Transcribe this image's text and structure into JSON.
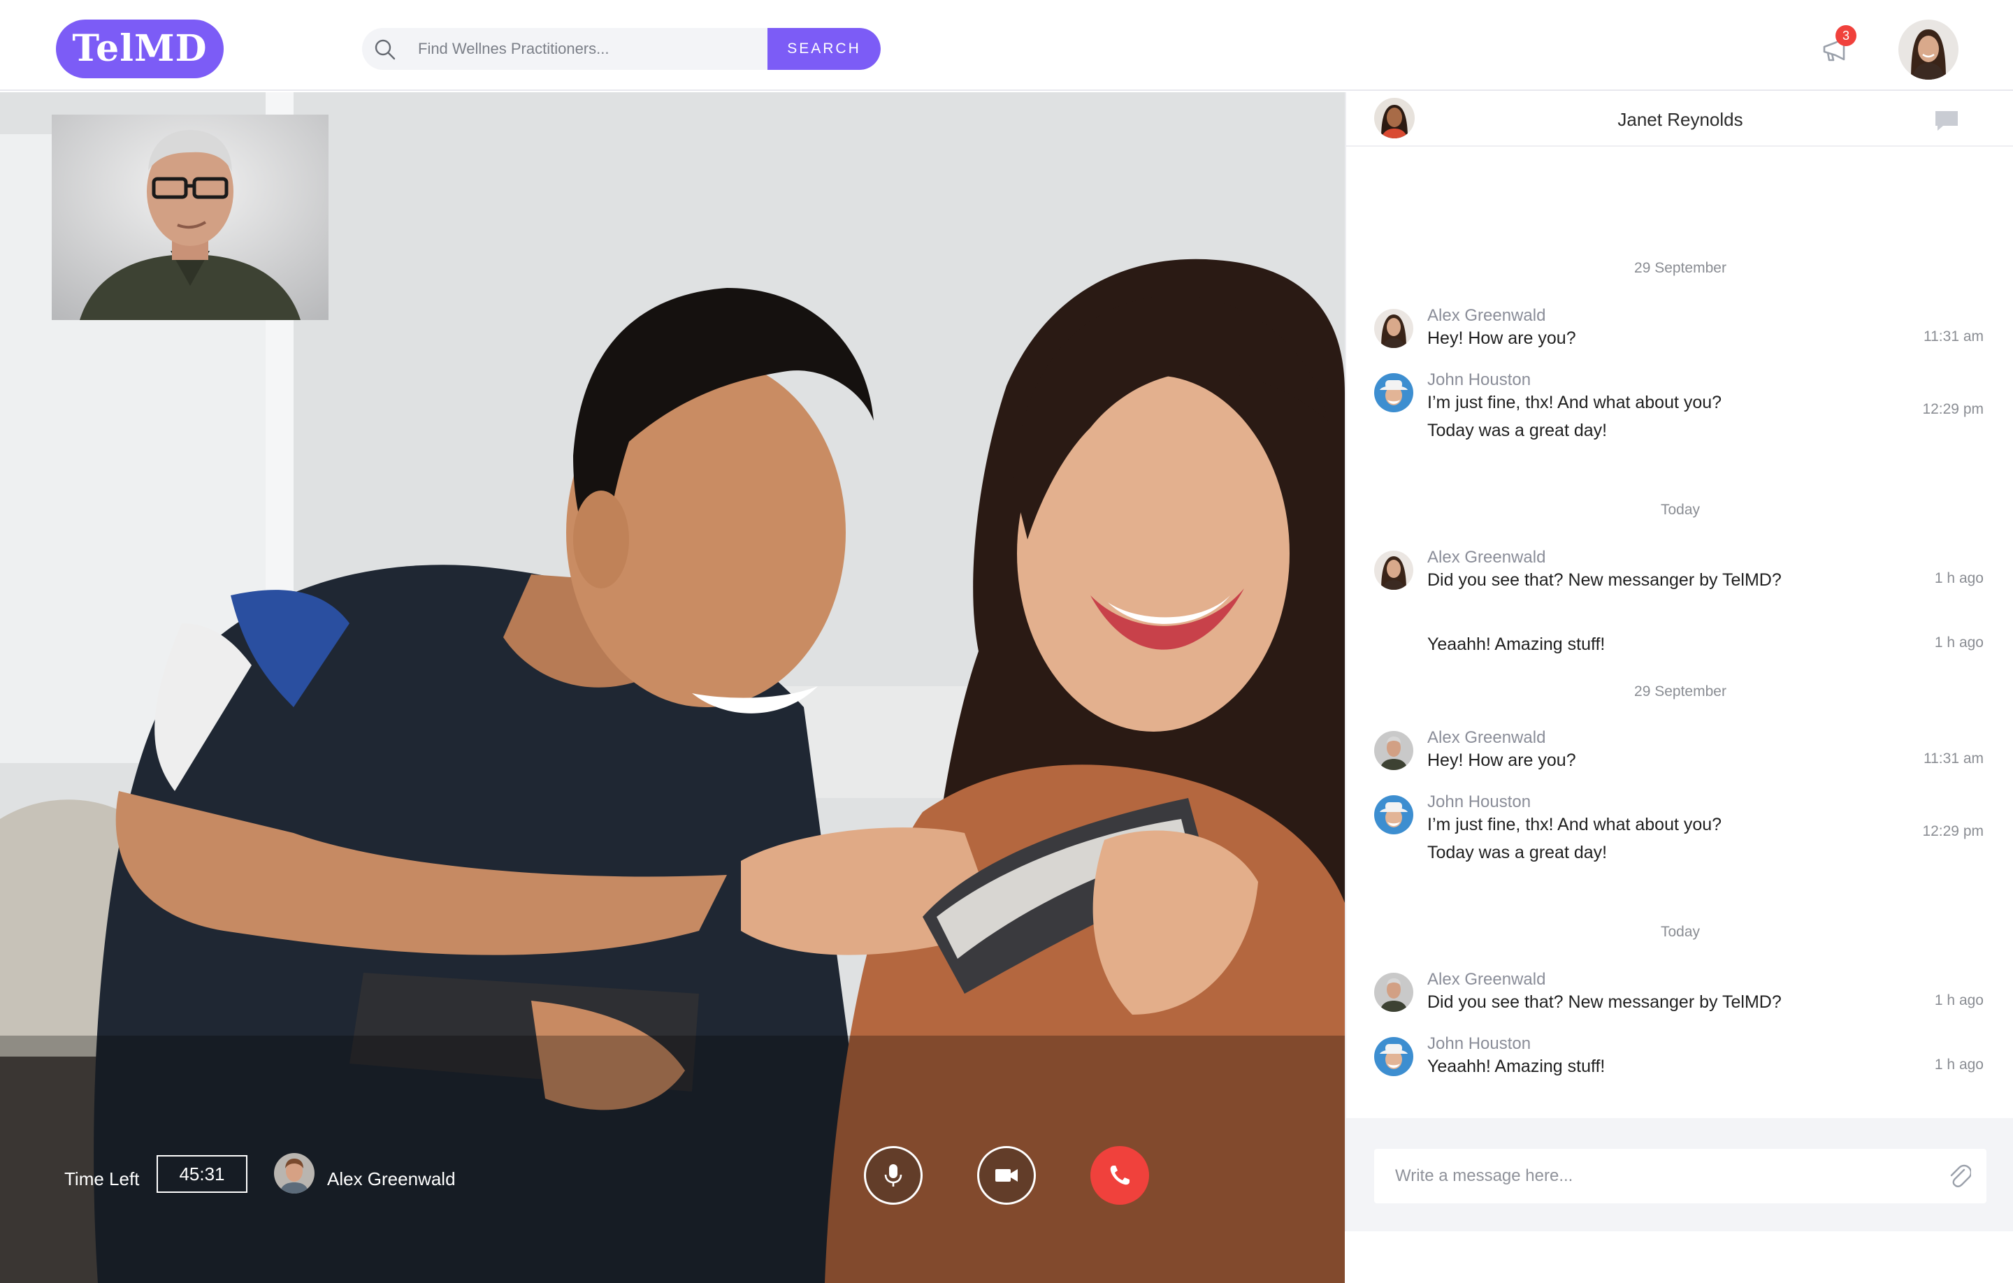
{
  "brand": {
    "logo_text": "TelMD",
    "accent": "#7c5cf6"
  },
  "search": {
    "placeholder": "Find Wellnes Practitioners...",
    "button_label": "SEARCH"
  },
  "header": {
    "notification_count": "3",
    "notification_icon": "megaphone-icon"
  },
  "video": {
    "time_left_label": "Time Left",
    "time_left_value": "45:31",
    "caller_name": "Alex Greenwald",
    "controls": [
      {
        "name": "microphone",
        "icon": "microphone-icon"
      },
      {
        "name": "camera",
        "icon": "video-camera-icon"
      },
      {
        "name": "end-call",
        "icon": "phone-icon",
        "color": "#f0413c"
      }
    ]
  },
  "chat": {
    "contact_name": "Janet Reynolds",
    "input_placeholder": "Write a message here...",
    "groups": [
      {
        "date": "29 September",
        "messages": [
          {
            "sender": "Alex Greenwald",
            "lines": [
              "Hey! How are you?"
            ],
            "time": "11:31 am"
          },
          {
            "sender": "John Houston",
            "lines": [
              "I’m just fine, thx! And what about you?",
              "Today was a great day!"
            ],
            "time": "12:29 pm"
          }
        ]
      },
      {
        "date": "Today",
        "messages": [
          {
            "sender": "Alex Greenwald",
            "lines": [
              "Did you see that? New messanger by TelMD?"
            ],
            "time": "1 h ago"
          },
          {
            "sender": "",
            "lines": [
              "Yeaahh! Amazing stuff!"
            ],
            "time": "1 h ago"
          }
        ]
      },
      {
        "date": "29 September",
        "messages": [
          {
            "sender": "Alex Greenwald",
            "lines": [
              "Hey! How are you?"
            ],
            "time": "11:31 am"
          },
          {
            "sender": "John Houston",
            "lines": [
              "I’m just fine, thx! And what about you?",
              "Today was a great day!"
            ],
            "time": "12:29 pm"
          }
        ]
      },
      {
        "date": "Today",
        "messages": [
          {
            "sender": "Alex Greenwald",
            "lines": [
              "Did you see that? New messanger by TelMD?"
            ],
            "time": "1 h ago"
          },
          {
            "sender": "John Houston",
            "lines": [
              "Yeaahh! Amazing stuff!"
            ],
            "time": "1 h ago"
          }
        ]
      }
    ]
  }
}
